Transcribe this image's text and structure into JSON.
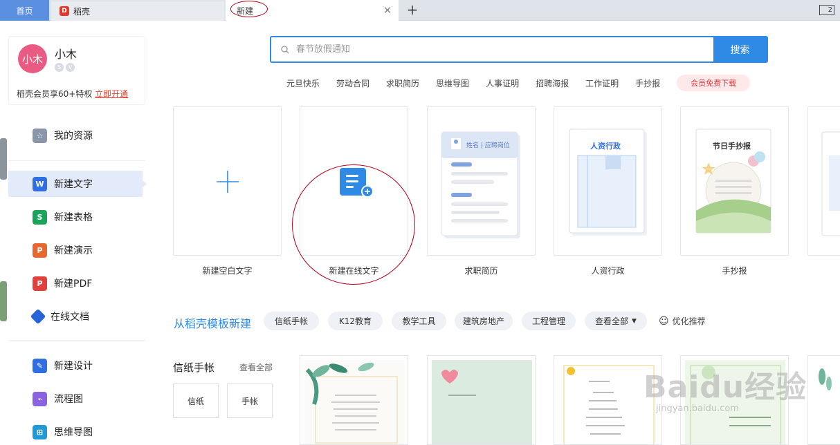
{
  "tabs": {
    "home": "首页",
    "daoke": "稻壳",
    "new": "新建",
    "window_count": "2"
  },
  "profile": {
    "avatar_text": "小木",
    "name": "小木",
    "vip_text": "稻壳会员享60+特权",
    "vip_link": "立即开通"
  },
  "sidebar": {
    "my_resources": "我的资源",
    "new_doc": "新建文字",
    "new_sheet": "新建表格",
    "new_ppt": "新建演示",
    "new_pdf": "新建PDF",
    "online_doc": "在线文档",
    "new_design": "新建设计",
    "flowchart": "流程图",
    "mindmap": "思维导图"
  },
  "search": {
    "placeholder": "春节放假通知",
    "button": "搜索"
  },
  "hot_keywords": [
    "元旦快乐",
    "劳动合同",
    "求职简历",
    "思维导图",
    "人事证明",
    "招聘海报",
    "工作证明",
    "手抄报"
  ],
  "vip_download": "会员免费下载",
  "cards": {
    "blank": "新建空白文字",
    "online": "新建在线文字",
    "resume": "求职简历",
    "hr": "人资行政",
    "handcopy": "手抄报",
    "resume_thumb_name": "姓名 | 应聘岗位",
    "hr_thumb_title": "人资行政",
    "handcopy_thumb_title": "节日手抄报"
  },
  "templates": {
    "title": "从稻壳模板新建",
    "chips": [
      "信纸手帐",
      "K12教育",
      "教学工具",
      "建筑房地产",
      "工程管理",
      "查看全部"
    ],
    "recommend": "优化推荐"
  },
  "stationery": {
    "title": "信纸手帐",
    "view_all": "查看全部",
    "btn_letter": "信纸",
    "btn_journal": "手帐"
  },
  "watermark": {
    "main": "Baidu经验",
    "sub": "jingyan.baidu.com"
  },
  "colors": {
    "accent": "#2f8ae5",
    "tab_home": "#5b8fe0",
    "annotation": "#b4001a",
    "avatar": "#ea5b84"
  }
}
